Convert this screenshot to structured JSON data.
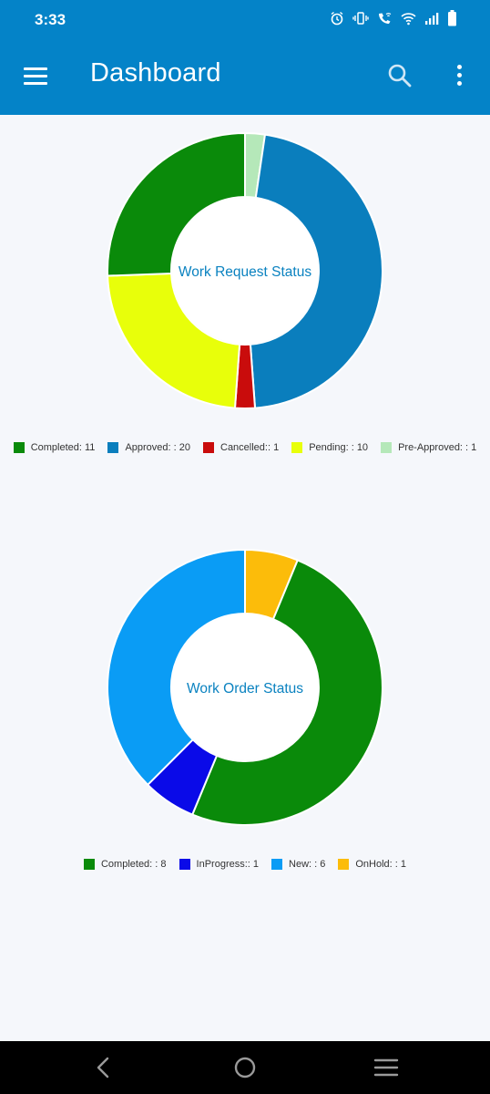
{
  "status_bar": {
    "time": "3:33",
    "icons": [
      "alarm-icon",
      "vibrate-icon",
      "wifi-call-icon",
      "wifi-icon",
      "signal-icon",
      "battery-icon"
    ]
  },
  "app_bar": {
    "title": "Dashboard",
    "background": "#0483c8",
    "icons": [
      "menu-icon",
      "search-icon",
      "more-vert-icon"
    ]
  },
  "chart_data": [
    {
      "type": "pie",
      "style": "donut",
      "title": "Work Request Status",
      "legend_position": "bottom",
      "slices": [
        {
          "label": "Completed: 11",
          "value": 11,
          "color": "#0a8a0a"
        },
        {
          "label": "Approved: : 20",
          "value": 20,
          "color": "#0a7ebd"
        },
        {
          "label": "Cancelled:: 1",
          "value": 1,
          "color": "#c90c0c"
        },
        {
          "label": "Pending: : 10",
          "value": 10,
          "color": "#e8ff0a"
        },
        {
          "label": "Pre-Approved: : 1",
          "value": 1,
          "color": "#b5e8b9"
        }
      ],
      "draw_order": [
        4,
        1,
        2,
        3,
        0
      ]
    },
    {
      "type": "pie",
      "style": "donut",
      "title": "Work Order Status",
      "legend_position": "bottom",
      "slices": [
        {
          "label": "Completed: : 8",
          "value": 8,
          "color": "#0a8a0a"
        },
        {
          "label": "InProgress:: 1",
          "value": 1,
          "color": "#0a0ae8"
        },
        {
          "label": "New: : 6",
          "value": 6,
          "color": "#0a9cf5"
        },
        {
          "label": "OnHold: : 1",
          "value": 1,
          "color": "#fcbc0a"
        }
      ],
      "draw_order": [
        3,
        0,
        1,
        2
      ]
    }
  ],
  "nav_bar": {
    "icons": [
      "back-icon",
      "home-icon",
      "recents-icon"
    ]
  }
}
